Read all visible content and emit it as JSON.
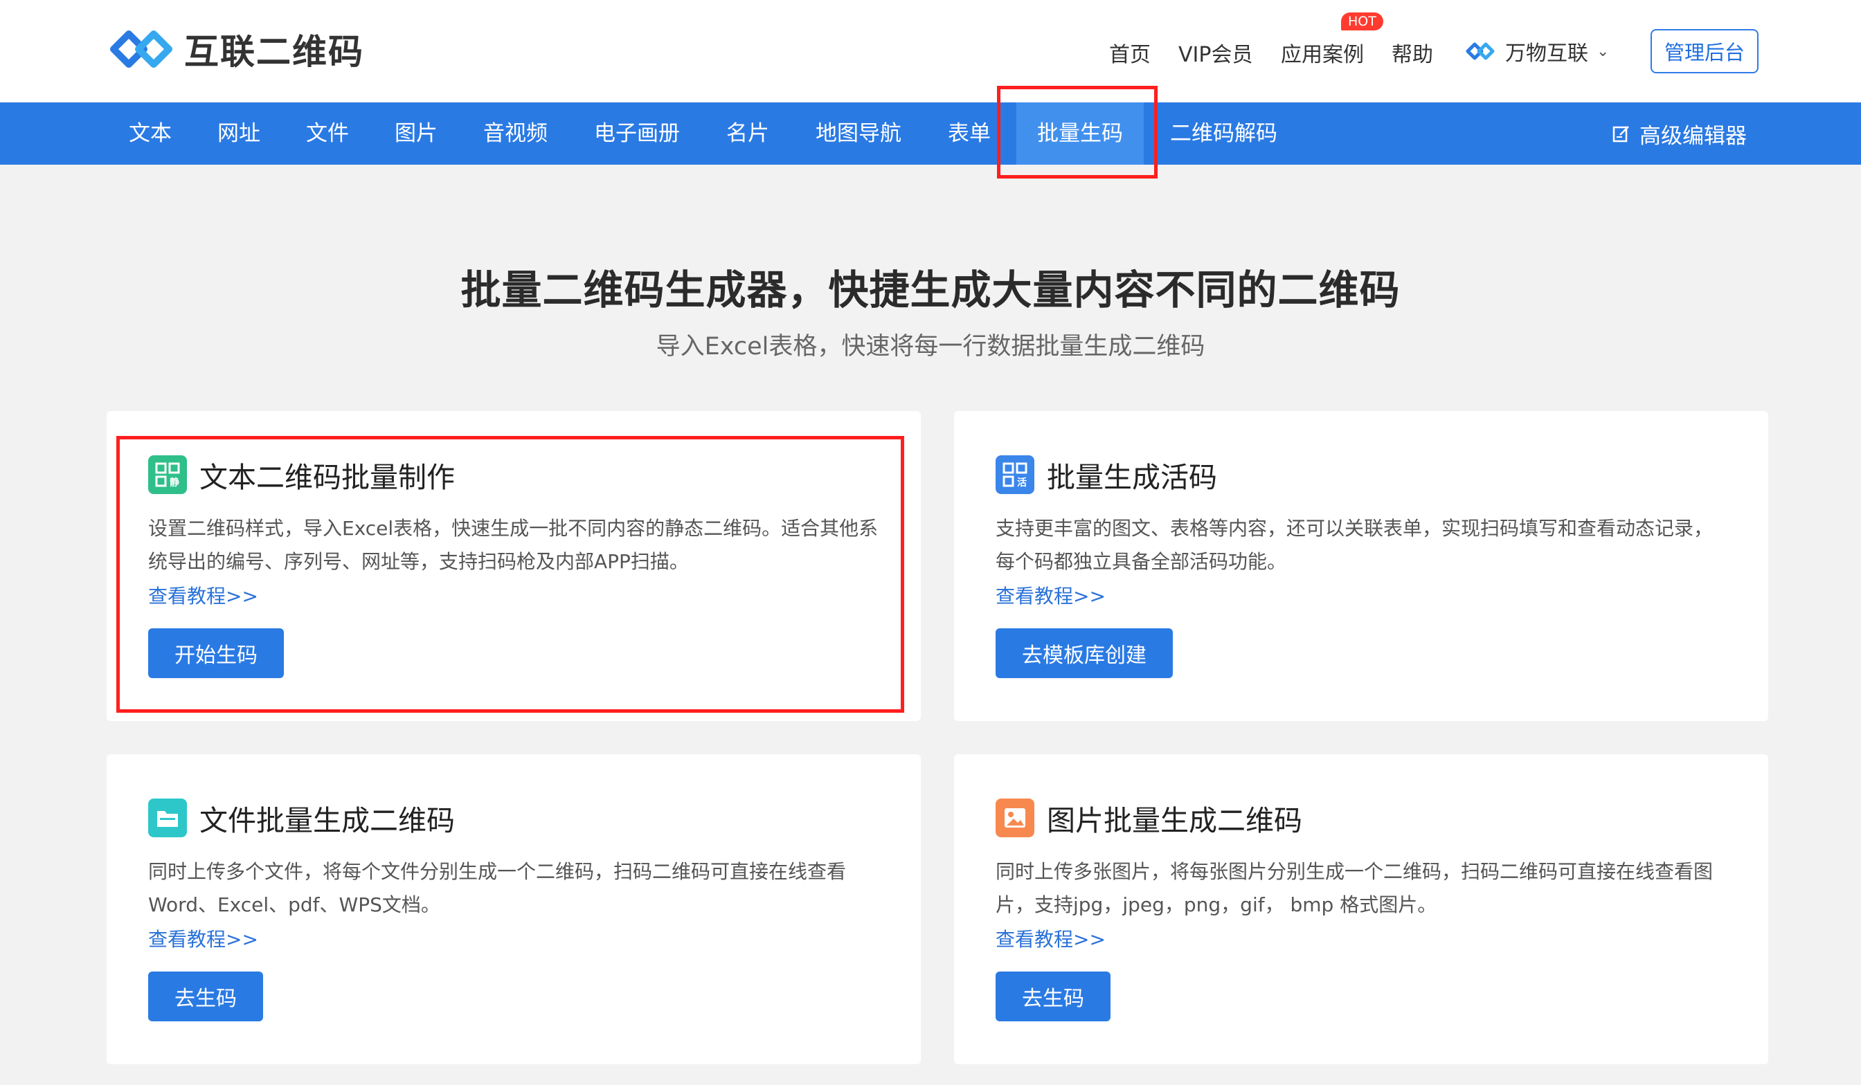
{
  "logo": {
    "text": "互联二维码"
  },
  "topnav": {
    "items": [
      "首页",
      "VIP会员",
      "应用案例",
      "帮助"
    ],
    "hot_badge": "HOT",
    "wanwu": "万物互联",
    "admin": "管理后台"
  },
  "bluenav": {
    "items": [
      "文本",
      "网址",
      "文件",
      "图片",
      "音视频",
      "电子画册",
      "名片",
      "地图导航",
      "表单",
      "批量生码",
      "二维码解码"
    ],
    "active": "批量生码",
    "advanced_editor": "高级编辑器"
  },
  "hero": {
    "title": "批量二维码生成器，快捷生成大量内容不同的二维码",
    "subtitle": "导入Excel表格，快速将每一行数据批量生成二维码"
  },
  "cards": [
    {
      "title": "文本二维码批量制作",
      "desc": "设置二维码样式，导入Excel表格，快速生成一批不同内容的静态二维码。适合其他系统导出的编号、序列号、网址等，支持扫码枪及内部APP扫描。",
      "link": "查看教程>>",
      "button": "开始生码",
      "icon": "qr-static-icon"
    },
    {
      "title": "批量生成活码",
      "desc": "支持更丰富的图文、表格等内容，还可以关联表单，实现扫码填写和查看动态记录，每个码都独立具备全部活码功能。",
      "link": "查看教程>>",
      "button": "去模板库创建",
      "icon": "qr-dynamic-icon"
    },
    {
      "title": "文件批量生成二维码",
      "desc": "同时上传多个文件，将每个文件分别生成一个二维码，扫码二维码可直接在线查看Word、Excel、pdf、WPS文档。",
      "link": "查看教程>>",
      "button": "去生码",
      "icon": "folder-icon"
    },
    {
      "title": "图片批量生成二维码",
      "desc": "同时上传多张图片，将每张图片分别生成一个二维码，扫码二维码可直接在线查看图片，支持jpg，jpeg，png，gif， bmp 格式图片。",
      "link": "查看教程>>",
      "button": "去生码",
      "icon": "image-icon"
    }
  ],
  "colors": {
    "brand_blue": "#2a7ae4",
    "highlight_red": "#ff1f1f",
    "hot_red": "#ff3b30"
  }
}
